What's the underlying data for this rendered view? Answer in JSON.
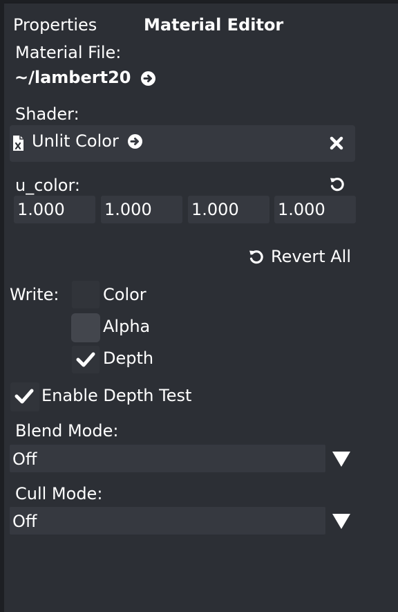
{
  "tabs": {
    "properties": "Properties",
    "material_editor": "Material Editor"
  },
  "material_file": {
    "label": "Material File:",
    "path": "~/lambert20",
    "open_icon": "circle-arrow-right-icon"
  },
  "shader": {
    "label": "Shader:",
    "name": "Unlit Color",
    "file_icon": "shader-file-icon",
    "open_icon": "circle-arrow-right-icon",
    "clear_icon": "close-icon"
  },
  "uniform": {
    "name": "u_color:",
    "revert_icon": "revert-icon",
    "values": [
      "1.000",
      "1.000",
      "1.000",
      "1.000"
    ]
  },
  "revert_all": {
    "label": "Revert All",
    "icon": "revert-icon"
  },
  "write": {
    "label": "Write:",
    "options": [
      {
        "label": "Color",
        "checked": false
      },
      {
        "label": "Alpha",
        "checked": false
      },
      {
        "label": "Depth",
        "checked": true
      }
    ]
  },
  "depth_test": {
    "label": "Enable Depth Test",
    "checked": true
  },
  "blend_mode": {
    "label": "Blend Mode:",
    "selected": "Off"
  },
  "cull_mode": {
    "label": "Cull Mode:",
    "selected": "Off"
  },
  "colors": {
    "background": "#2c2f35",
    "field": "#363940",
    "text": "#ffffff"
  }
}
